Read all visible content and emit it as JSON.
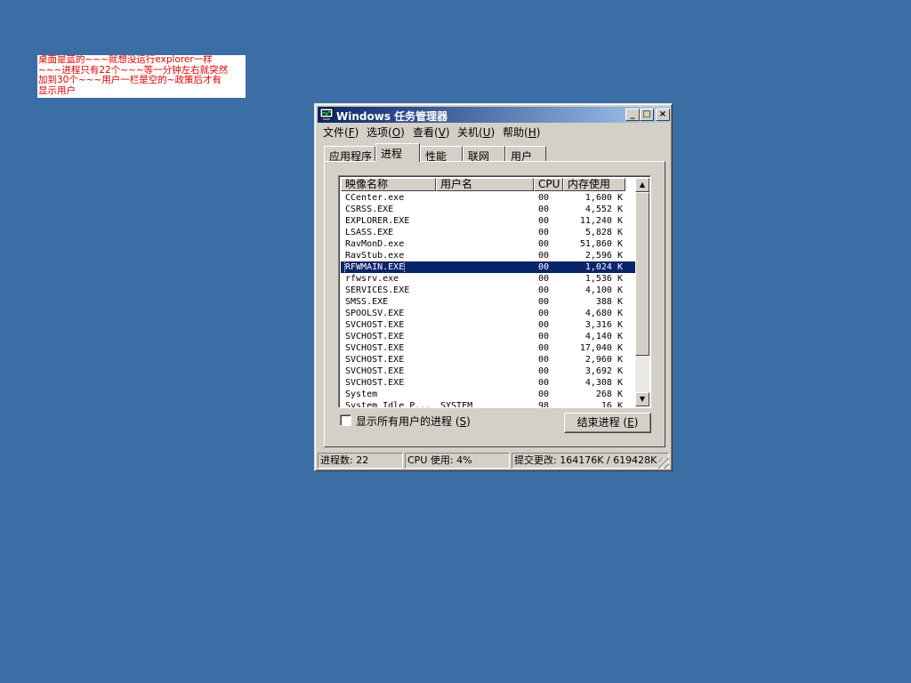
{
  "note": {
    "lines": [
      "桌面是蓝的~~~就想没运行explorer一样",
      "~~~进程只有22个~~~等一分钟左右就突然",
      "加到30个~~~用户一栏是空的~政策后才有",
      "显示用户"
    ]
  },
  "window": {
    "title": "Windows 任务管理器",
    "controls": {
      "minimize": "_",
      "maximize": "□",
      "close": "×"
    }
  },
  "menu": [
    {
      "label": "文件(",
      "key": "F",
      "close": ")"
    },
    {
      "label": "选项(",
      "key": "O",
      "close": ")"
    },
    {
      "label": "查看(",
      "key": "V",
      "close": ")"
    },
    {
      "label": "关机(",
      "key": "U",
      "close": ")"
    },
    {
      "label": "帮助(",
      "key": "H",
      "close": ")"
    }
  ],
  "tabs": [
    "应用程序",
    "进程",
    "性能",
    "联网",
    "用户"
  ],
  "active_tab": "进程",
  "columns": [
    "映像名称",
    "用户名",
    "CPU",
    "内存使用"
  ],
  "processes": [
    {
      "name": "CCenter.exe",
      "user": "",
      "cpu": "00",
      "mem": "1,600 K"
    },
    {
      "name": "CSRSS.EXE",
      "user": "",
      "cpu": "00",
      "mem": "4,552 K"
    },
    {
      "name": "EXPLORER.EXE",
      "user": "",
      "cpu": "00",
      "mem": "11,240 K"
    },
    {
      "name": "LSASS.EXE",
      "user": "",
      "cpu": "00",
      "mem": "5,828 K"
    },
    {
      "name": "RavMonD.exe",
      "user": "",
      "cpu": "00",
      "mem": "51,860 K"
    },
    {
      "name": "RavStub.exe",
      "user": "",
      "cpu": "00",
      "mem": "2,596 K"
    },
    {
      "name": "RFWMAIN.EXE",
      "user": "",
      "cpu": "00",
      "mem": "1,024 K"
    },
    {
      "name": "rfwsrv.exe",
      "user": "",
      "cpu": "00",
      "mem": "1,536 K"
    },
    {
      "name": "SERVICES.EXE",
      "user": "",
      "cpu": "00",
      "mem": "4,100 K"
    },
    {
      "name": "SMSS.EXE",
      "user": "",
      "cpu": "00",
      "mem": "388 K"
    },
    {
      "name": "SPOOLSV.EXE",
      "user": "",
      "cpu": "00",
      "mem": "4,680 K"
    },
    {
      "name": "SVCHOST.EXE",
      "user": "",
      "cpu": "00",
      "mem": "3,316 K"
    },
    {
      "name": "SVCHOST.EXE",
      "user": "",
      "cpu": "00",
      "mem": "4,140 K"
    },
    {
      "name": "SVCHOST.EXE",
      "user": "",
      "cpu": "00",
      "mem": "17,040 K"
    },
    {
      "name": "SVCHOST.EXE",
      "user": "",
      "cpu": "00",
      "mem": "2,960 K"
    },
    {
      "name": "SVCHOST.EXE",
      "user": "",
      "cpu": "00",
      "mem": "3,692 K"
    },
    {
      "name": "SVCHOST.EXE",
      "user": "",
      "cpu": "00",
      "mem": "4,308 K"
    },
    {
      "name": "System",
      "user": "",
      "cpu": "00",
      "mem": "268 K"
    },
    {
      "name": "System Idle P...",
      "user": "SYSTEM",
      "cpu": "98",
      "mem": "16 K"
    }
  ],
  "selected_process": "RFWMAIN.EXE",
  "show_all_users": {
    "label": "显示所有用户的进程 (",
    "key": "S",
    "close": ")",
    "checked": false
  },
  "end_process_button": {
    "label": "结束进程 (",
    "key": "E",
    "close": ")"
  },
  "status": {
    "processes": "进程数: 22",
    "cpu": "CPU 使用: 4%",
    "commit": "提交更改: 164176K / 619428K"
  }
}
